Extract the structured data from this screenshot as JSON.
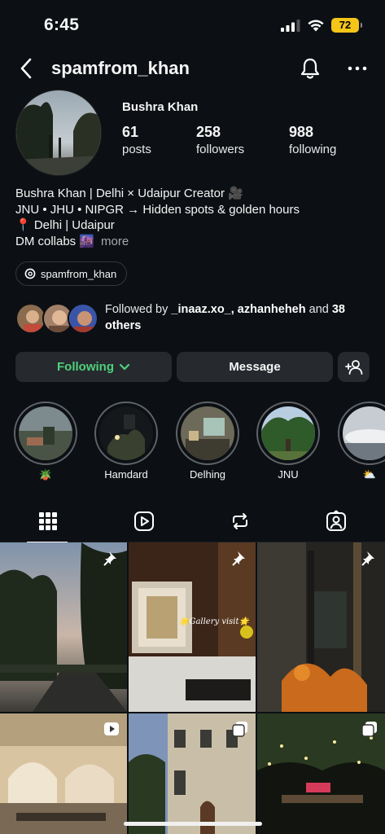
{
  "status_bar": {
    "time": "6:45",
    "battery": "72"
  },
  "header": {
    "username": "spamfrom_khan"
  },
  "profile": {
    "display_name": "Bushra Khan",
    "stats": [
      {
        "value": "61",
        "label": "posts"
      },
      {
        "value": "258",
        "label": "followers"
      },
      {
        "value": "988",
        "label": "following"
      }
    ],
    "bio_lines": [
      "Bushra Khan | Delhi × Udaipur Creator 🎥",
      "JNU • JHU • NIPGR → Hidden spots & golden hours",
      "📍 Delhi | Udaipur",
      "DM collabs 🌆"
    ],
    "more_label": "more",
    "threads_handle": "spamfrom_khan"
  },
  "followed_by": {
    "prefix": "Followed by ",
    "names": "_inaaz.xo_, azhanheheh",
    "middle": " and ",
    "others": "38 others"
  },
  "buttons": {
    "following_label": "Following",
    "message_label": "Message"
  },
  "highlights": [
    {
      "label": "🪴"
    },
    {
      "label": "Hamdard"
    },
    {
      "label": "Delhing"
    },
    {
      "label": "JNU"
    },
    {
      "label": "⛅"
    }
  ],
  "tabs": [
    "grid",
    "reels",
    "reposts",
    "tagged"
  ],
  "grid_posts": [
    {
      "type": "pinned"
    },
    {
      "type": "pinned",
      "caption": "🌟Gallery visit🌟"
    },
    {
      "type": "pinned"
    },
    {
      "type": "reel"
    },
    {
      "type": "carousel"
    },
    {
      "type": "carousel"
    }
  ],
  "colors": {
    "background": "#0c1014",
    "button": "#262a2f",
    "following_green": "#4fd17a"
  }
}
